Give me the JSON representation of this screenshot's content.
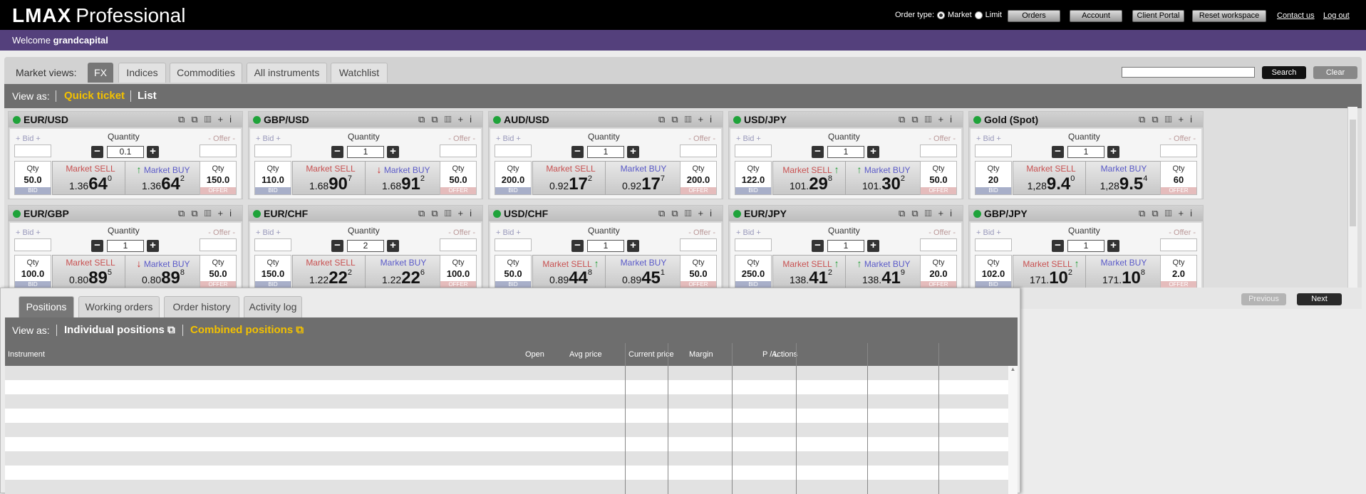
{
  "header": {
    "logo_bold": "LMAX",
    "logo_light": "Professional",
    "order_type_label": "Order type:",
    "order_type_options": [
      "Market",
      "Limit"
    ],
    "order_type_selected": "Market",
    "buttons": [
      "Orders",
      "Account",
      "Client Portal",
      "Reset workspace"
    ],
    "links": [
      "Contact us",
      "Log out"
    ]
  },
  "welcome": {
    "prefix": "Welcome",
    "user": "grandcapital"
  },
  "market_views": {
    "label": "Market views:",
    "tabs": [
      "FX",
      "Indices",
      "Commodities",
      "All instruments",
      "Watchlist"
    ],
    "active_tab": "FX",
    "search_label": "Search",
    "clear_label": "Clear",
    "search_value": ""
  },
  "view_as": {
    "label": "View as:",
    "options": [
      "Quick ticket",
      "List"
    ],
    "active": "Quick ticket"
  },
  "ticket_labels": {
    "bid": "+ Bid +",
    "offer": "- Offer -",
    "quantity": "Quantity",
    "qty": "Qty",
    "market_sell": "Market SELL",
    "market_buy": "Market BUY",
    "bid_tag": "BID",
    "offer_tag": "OFFER",
    "minus": "−",
    "plus": "+"
  },
  "tiles": [
    {
      "name": "EUR/USD",
      "qty": "0.1",
      "bid_qty": "50.0",
      "offer_qty": "150.0",
      "sell": {
        "pre": "1.36",
        "big": "64",
        "pip": "0"
      },
      "buy": {
        "pre": "1.36",
        "big": "64",
        "pip": "2"
      },
      "sell_arrow": "",
      "buy_arrow": "up"
    },
    {
      "name": "GBP/USD",
      "qty": "1",
      "bid_qty": "110.0",
      "offer_qty": "50.0",
      "sell": {
        "pre": "1.68",
        "big": "90",
        "pip": "7"
      },
      "buy": {
        "pre": "1.68",
        "big": "91",
        "pip": "2"
      },
      "sell_arrow": "",
      "buy_arrow": "down"
    },
    {
      "name": "AUD/USD",
      "qty": "1",
      "bid_qty": "200.0",
      "offer_qty": "200.0",
      "sell": {
        "pre": "0.92",
        "big": "17",
        "pip": "2"
      },
      "buy": {
        "pre": "0.92",
        "big": "17",
        "pip": "7"
      },
      "sell_arrow": "",
      "buy_arrow": ""
    },
    {
      "name": "USD/JPY",
      "qty": "1",
      "bid_qty": "122.0",
      "offer_qty": "50.0",
      "sell": {
        "pre": "101.",
        "big": "29",
        "pip": "8"
      },
      "buy": {
        "pre": "101.",
        "big": "30",
        "pip": "2"
      },
      "sell_arrow": "up",
      "buy_arrow": "up"
    },
    {
      "name": "Gold (Spot)",
      "qty": "1",
      "bid_qty": "20",
      "offer_qty": "60",
      "sell": {
        "pre": "1,28",
        "big": "9.4",
        "pip": "0"
      },
      "buy": {
        "pre": "1,28",
        "big": "9.5",
        "pip": "4"
      },
      "sell_arrow": "",
      "buy_arrow": ""
    },
    {
      "name": "EUR/GBP",
      "qty": "1",
      "bid_qty": "100.0",
      "offer_qty": "50.0",
      "sell": {
        "pre": "0.80",
        "big": "89",
        "pip": "5"
      },
      "buy": {
        "pre": "0.80",
        "big": "89",
        "pip": "8"
      },
      "sell_arrow": "",
      "buy_arrow": "down"
    },
    {
      "name": "EUR/CHF",
      "qty": "2",
      "bid_qty": "150.0",
      "offer_qty": "100.0",
      "sell": {
        "pre": "1.22",
        "big": "22",
        "pip": "2"
      },
      "buy": {
        "pre": "1.22",
        "big": "22",
        "pip": "6"
      },
      "sell_arrow": "",
      "buy_arrow": ""
    },
    {
      "name": "USD/CHF",
      "qty": "1",
      "bid_qty": "50.0",
      "offer_qty": "50.0",
      "sell": {
        "pre": "0.89",
        "big": "44",
        "pip": "8"
      },
      "buy": {
        "pre": "0.89",
        "big": "45",
        "pip": "1"
      },
      "sell_arrow": "up",
      "buy_arrow": ""
    },
    {
      "name": "EUR/JPY",
      "qty": "1",
      "bid_qty": "250.0",
      "offer_qty": "20.0",
      "sell": {
        "pre": "138.",
        "big": "41",
        "pip": "2"
      },
      "buy": {
        "pre": "138.",
        "big": "41",
        "pip": "9"
      },
      "sell_arrow": "up",
      "buy_arrow": "up"
    },
    {
      "name": "GBP/JPY",
      "qty": "1",
      "bid_qty": "102.0",
      "offer_qty": "2.0",
      "sell": {
        "pre": "171.",
        "big": "10",
        "pip": "2"
      },
      "buy": {
        "pre": "171.",
        "big": "10",
        "pip": "8"
      },
      "sell_arrow": "up",
      "buy_arrow": ""
    }
  ],
  "pager": {
    "previous": "Previous",
    "next": "Next"
  },
  "positions_panel": {
    "tabs": [
      "Positions",
      "Working orders",
      "Order history",
      "Activity log"
    ],
    "active_tab": "Positions",
    "view_as_label": "View as:",
    "view_options": [
      "Individual positions",
      "Combined positions"
    ],
    "active_view": "Combined positions",
    "columns": [
      "Instrument",
      "Open",
      "Avg price",
      "Current price",
      "Margin",
      "P / L",
      "Actions"
    ],
    "rows": []
  },
  "colors": {
    "purple_bar": "#54407c",
    "accent_yellow": "#f3c100",
    "up_green": "#1b9b2f",
    "down_red": "#c92a2a"
  },
  "icons": [
    "popout-icon",
    "chart-icon",
    "add-watchlist-icon",
    "info-icon"
  ]
}
